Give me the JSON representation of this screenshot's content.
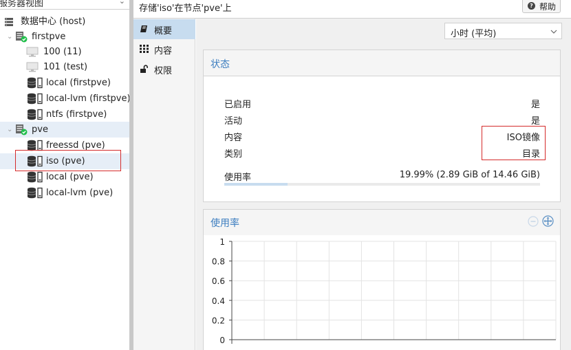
{
  "tree": {
    "view_label": "服务器视图",
    "datacenter": "数据中心 (host)",
    "nodes": [
      {
        "name": "firstpve",
        "items": [
          "100 (11)",
          "101 (test)",
          "local (firstpve)",
          "local-lvm (firstpve)",
          "ntfs (firstpve)"
        ]
      },
      {
        "name": "pve",
        "items": [
          "freessd (pve)",
          "iso (pve)",
          "local (pve)",
          "local-lvm (pve)"
        ]
      }
    ]
  },
  "header": {
    "title": "存储'iso'在节点'pve'上",
    "help_label": "帮助"
  },
  "tabs": [
    {
      "label": "概要",
      "icon": "book-icon",
      "active": true
    },
    {
      "label": "内容",
      "icon": "grid-icon",
      "active": false
    },
    {
      "label": "权限",
      "icon": "unlock-icon",
      "active": false
    }
  ],
  "timeframe": {
    "selected": "小时 (平均)"
  },
  "status": {
    "title": "状态",
    "rows": [
      {
        "label": "已启用",
        "value": "是"
      },
      {
        "label": "活动",
        "value": "是"
      },
      {
        "label": "内容",
        "value": "ISO镜像"
      },
      {
        "label": "类别",
        "value": "目录"
      }
    ],
    "usage_label": "使用率",
    "usage_value": "19.99% (2.89 GiB of 14.46 GiB)",
    "usage_fraction": 0.1999
  },
  "usage_chart": {
    "title": "使用率",
    "chart_data": {
      "type": "line",
      "ylim": [
        0,
        1
      ],
      "y_ticks": [
        "1",
        "0.8",
        "0.6",
        "0.4",
        "0.2",
        "0"
      ],
      "grid": true,
      "series": []
    }
  },
  "colors": {
    "accent": "#3d7ec0",
    "highlight": "#e6eef7",
    "tab_active": "#c7dcef",
    "annotation_red": "#d42a2a",
    "ok_green": "#21bf4b"
  }
}
